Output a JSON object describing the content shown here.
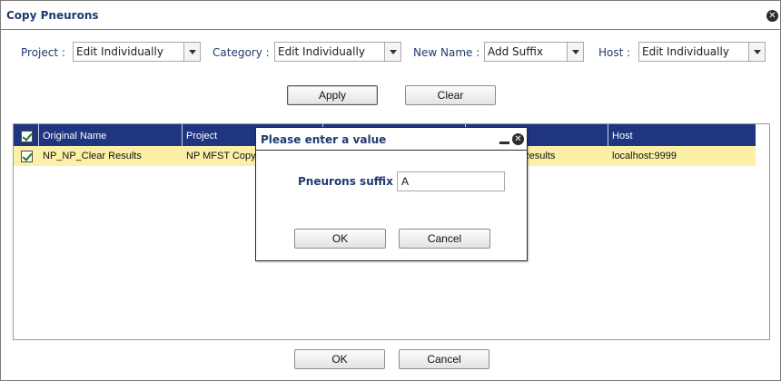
{
  "window": {
    "title": "Copy Pneurons"
  },
  "filters": {
    "project": {
      "label": "Project :",
      "value": "Edit Individually"
    },
    "category": {
      "label": "Category :",
      "value": "Edit Individually"
    },
    "new_name": {
      "label": "New Name :",
      "value": "Add Suffix"
    },
    "host": {
      "label": "Host :",
      "value": "Edit Individually"
    }
  },
  "toolbar": {
    "apply_label": "Apply",
    "clear_label": "Clear"
  },
  "grid": {
    "columns": [
      "Original Name",
      "Project",
      "",
      "",
      "Host"
    ],
    "rows": [
      {
        "checked": true,
        "original_name": "NP_NP_Clear Results",
        "project": "NP MFST Copy",
        "new_name_visible": "r Results",
        "host": "localhost:9999"
      }
    ]
  },
  "dialog": {
    "title": "Please enter a value",
    "field_label": "Pneurons suffix :",
    "field_value": "A",
    "ok_label": "OK",
    "cancel_label": "Cancel"
  },
  "footer": {
    "ok_label": "OK",
    "cancel_label": "Cancel"
  },
  "icons": {
    "close": "close-icon",
    "minimize": "minimize-icon",
    "dropdown": "chevron-down-icon",
    "checkbox": "checkbox-checked-icon"
  }
}
